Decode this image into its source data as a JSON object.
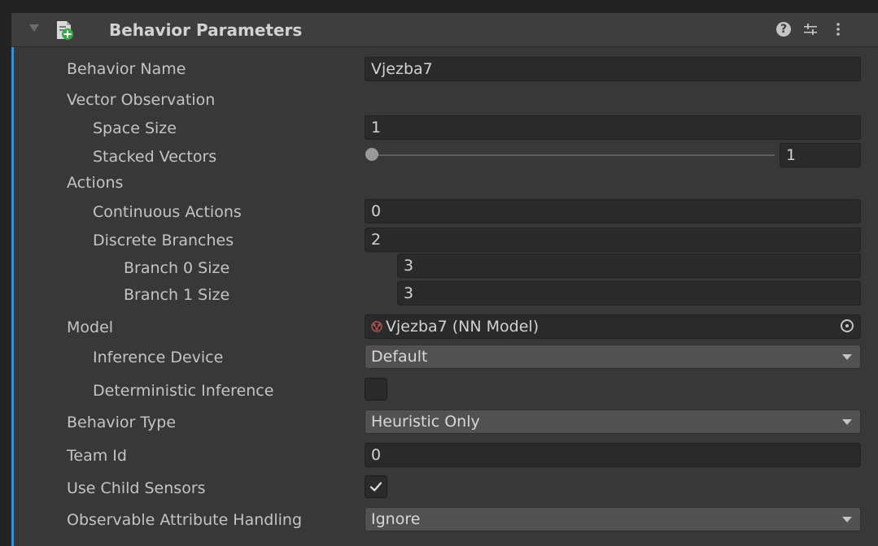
{
  "header": {
    "title": "Behavior Parameters",
    "help_glyph": "?",
    "icons": [
      "script-icon",
      "help-icon",
      "preset-icon",
      "more-icon"
    ]
  },
  "fields": {
    "behavior_name": {
      "label": "Behavior Name",
      "value": "Vjezba7"
    },
    "vector_observation": {
      "label": "Vector Observation"
    },
    "space_size": {
      "label": "Space Size",
      "value": "1"
    },
    "stacked_vectors": {
      "label": "Stacked Vectors",
      "value": "1",
      "slider_fraction": 0.0
    },
    "actions": {
      "label": "Actions"
    },
    "continuous_actions": {
      "label": "Continuous Actions",
      "value": "0"
    },
    "discrete_branches": {
      "label": "Discrete Branches",
      "value": "2"
    },
    "branch0": {
      "label": "Branch 0 Size",
      "value": "3"
    },
    "branch1": {
      "label": "Branch 1 Size",
      "value": "3"
    },
    "model": {
      "label": "Model",
      "value": "Vjezba7 (NN Model)"
    },
    "inference_device": {
      "label": "Inference Device",
      "value": "Default"
    },
    "deterministic_inference": {
      "label": "Deterministic Inference",
      "checked": false
    },
    "behavior_type": {
      "label": "Behavior Type",
      "value": "Heuristic Only"
    },
    "team_id": {
      "label": "Team Id",
      "value": "0"
    },
    "use_child_sensors": {
      "label": "Use Child Sensors",
      "checked": true
    },
    "observable_attribute_handling": {
      "label": "Observable Attribute Handling",
      "value": "Ignore"
    }
  },
  "colors": {
    "background": "#383838",
    "field": "#2a2a2a",
    "dropdown": "#515151",
    "accent": "#3a8fd6",
    "text": "#c4c4c4"
  }
}
